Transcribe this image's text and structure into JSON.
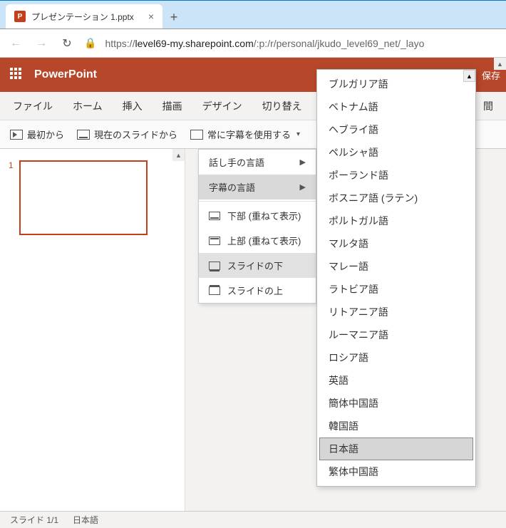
{
  "browser": {
    "tab_title": "プレゼンテーション 1.pptx",
    "url_prefix": "https://",
    "url_host": "level69-my.sharepoint.com",
    "url_path": "/:p:/r/personal/jkudo_level69_net/_layo"
  },
  "header": {
    "brand": "PowerPoint",
    "save": "保存"
  },
  "ribbon_tabs": [
    "ファイル",
    "ホーム",
    "挿入",
    "描画",
    "デザイン",
    "切り替え",
    "間"
  ],
  "commands": {
    "from_start": "最初から",
    "from_current": "現在のスライドから",
    "always_subtitles": "常に字幕を使用する"
  },
  "thumb": {
    "num": "1"
  },
  "subtitle_menu": {
    "speaker_lang": "話し手の言語",
    "subtitle_lang": "字幕の言語",
    "bottom_overlay": "下部 (重ねて表示)",
    "top_overlay": "上部 (重ねて表示)",
    "below_slide": "スライドの下",
    "above_slide": "スライドの上"
  },
  "languages": [
    "ブルガリア語",
    "ベトナム語",
    "ヘブライ語",
    "ペルシャ語",
    "ポーランド語",
    "ボスニア語 (ラテン)",
    "ポルトガル語",
    "マルタ語",
    "マレー語",
    "ラトビア語",
    "リトアニア語",
    "ルーマニア語",
    "ロシア語",
    "英語",
    "簡体中国語",
    "韓国語",
    "日本語",
    "繁体中国語"
  ],
  "selected_language_index": 16,
  "status": {
    "slide": "スライド 1/1",
    "lang": "日本語"
  }
}
